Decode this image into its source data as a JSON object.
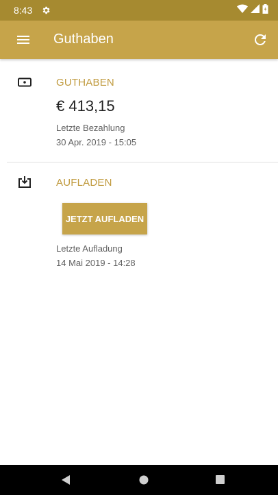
{
  "status_bar": {
    "time": "8:43",
    "icons": [
      "settings-icon",
      "wifi-icon",
      "signal-icon",
      "battery-icon"
    ]
  },
  "app_bar": {
    "title": "Guthaben",
    "menu_icon": "menu-icon",
    "refresh_icon": "refresh-icon",
    "color": "#c6a44a"
  },
  "balance_section": {
    "icon": "wallet-icon",
    "title": "GUTHABEN",
    "amount": "€ 413,15",
    "last_payment_label": "Letzte Bezahlung",
    "last_payment_date": "30 Apr. 2019 - 15:05"
  },
  "topup_section": {
    "icon": "download-box-icon",
    "title": "AUFLADEN",
    "button_label": "JETZT AUFLADEN",
    "last_topup_label": "Letzte Aufladung",
    "last_topup_date": "14 Mai 2019 - 14:28"
  },
  "nav_bar": {
    "icons": [
      "back-icon",
      "home-icon",
      "recents-icon"
    ]
  },
  "colors": {
    "accent": "#c6a44a",
    "status_bar": "#a68a30",
    "section_title": "#c09a3e"
  }
}
